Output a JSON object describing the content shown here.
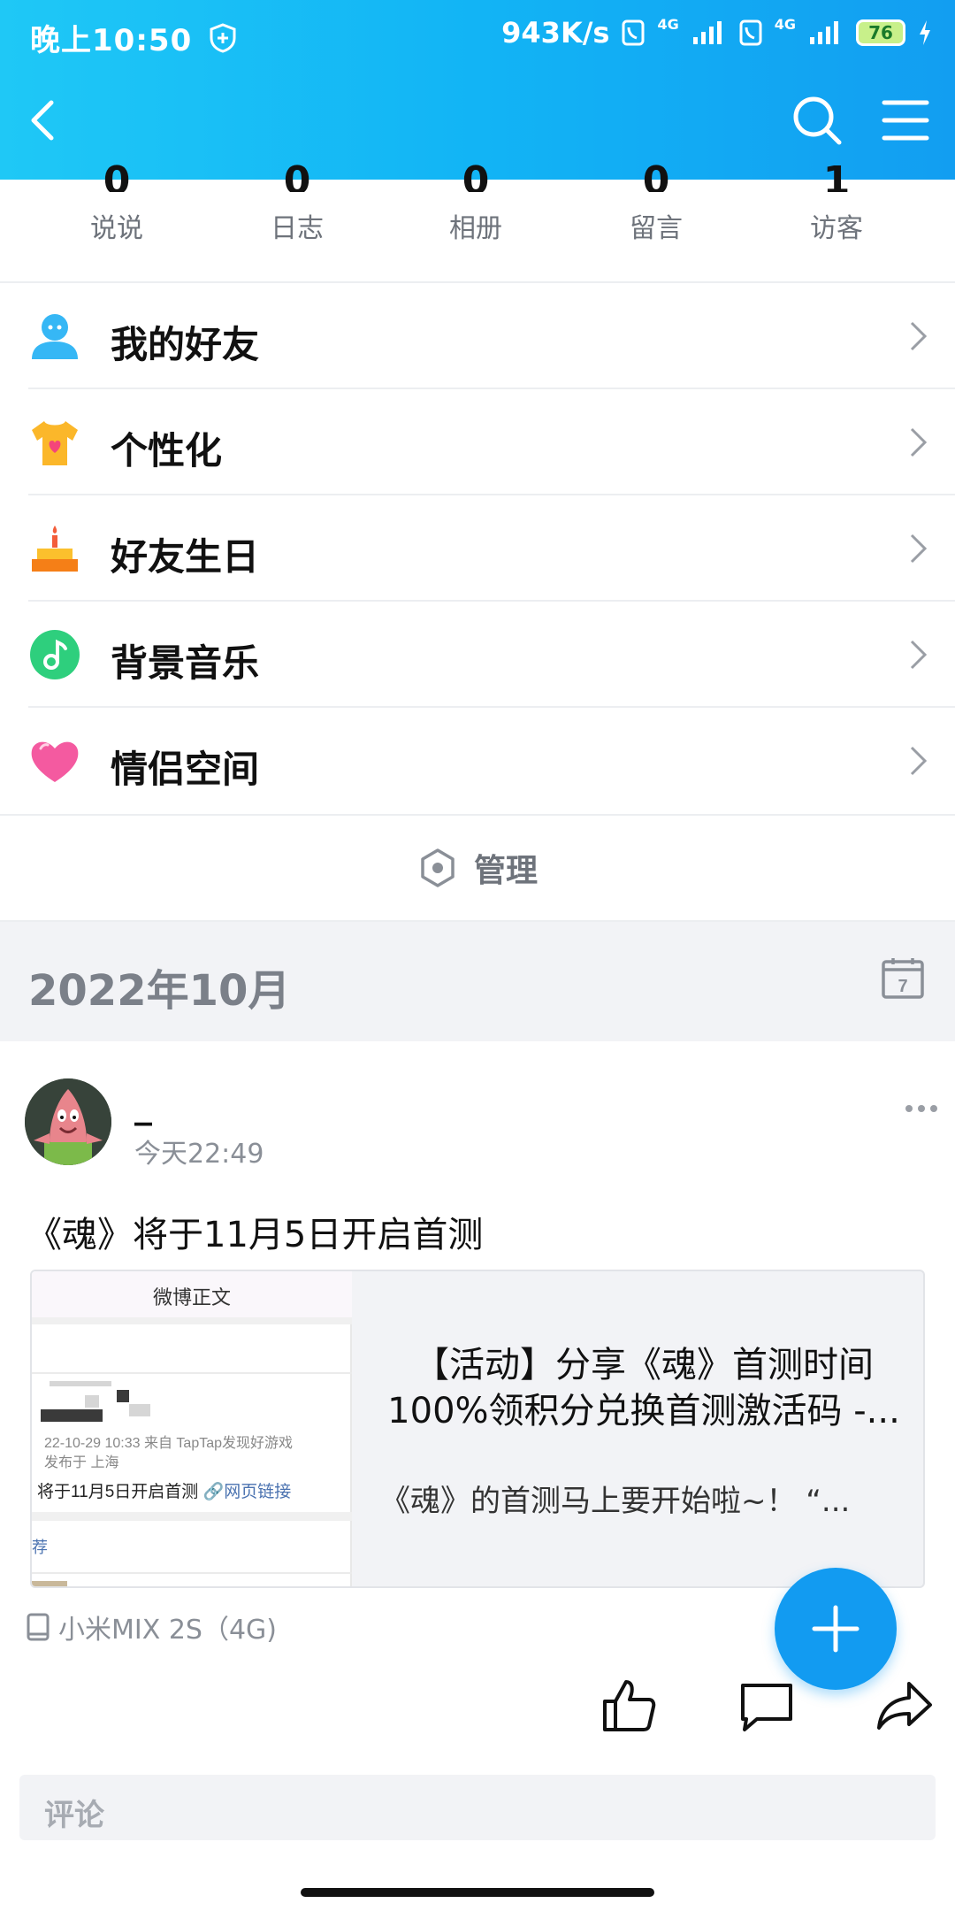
{
  "status_bar": {
    "time": "晚上10:50",
    "speed": "943K/s",
    "network_1": "4G",
    "network_2": "4G",
    "battery": "76"
  },
  "header": {
    "back_icon": "back-arrow-icon",
    "search_icon": "search-icon",
    "menu_icon": "menu-icon",
    "gradient": [
      "#1fc8f6",
      "#129ef1"
    ]
  },
  "stats": [
    {
      "value": "0",
      "label": "说说"
    },
    {
      "value": "0",
      "label": "日志"
    },
    {
      "value": "0",
      "label": "相册"
    },
    {
      "value": "0",
      "label": "留言"
    },
    {
      "value": "1",
      "label": "访客"
    }
  ],
  "menu": [
    {
      "label": "我的好友",
      "icon": "friends-icon"
    },
    {
      "label": "个性化",
      "icon": "shirt-icon"
    },
    {
      "label": "好友生日",
      "icon": "cake-icon"
    },
    {
      "label": "背景音乐",
      "icon": "music-icon"
    },
    {
      "label": "情侣空间",
      "icon": "heart-icon"
    }
  ],
  "manage": {
    "label": "管理",
    "icon": "hexagon-settings-icon"
  },
  "month": {
    "title": "2022年10月",
    "calendar_day": "7"
  },
  "post": {
    "author": "_",
    "time": "今天22:49",
    "text": "《魂》将于11月5日开启首测",
    "link": {
      "thumb_header": "微博正文",
      "thumb_meta_1": "22-10-29 10:33  来自 TapTap发现好游戏",
      "thumb_meta_2": "发布于 上海",
      "thumb_body": "将于11月5日开启首测 ",
      "thumb_link": "🔗网页链接",
      "thumb_rec": "荐",
      "title": "【活动】分享《魂》首测时间100%领积分兑换首测激活码 -...",
      "desc": "《魂》的首测马上要开始啦~！ “..."
    },
    "device": "小米MIX 2S（4G)",
    "comment_placeholder": "评论"
  },
  "colors": {
    "accent": "#129bf1",
    "muted_text": "#8a8f97",
    "band_bg": "#f2f3f6"
  }
}
